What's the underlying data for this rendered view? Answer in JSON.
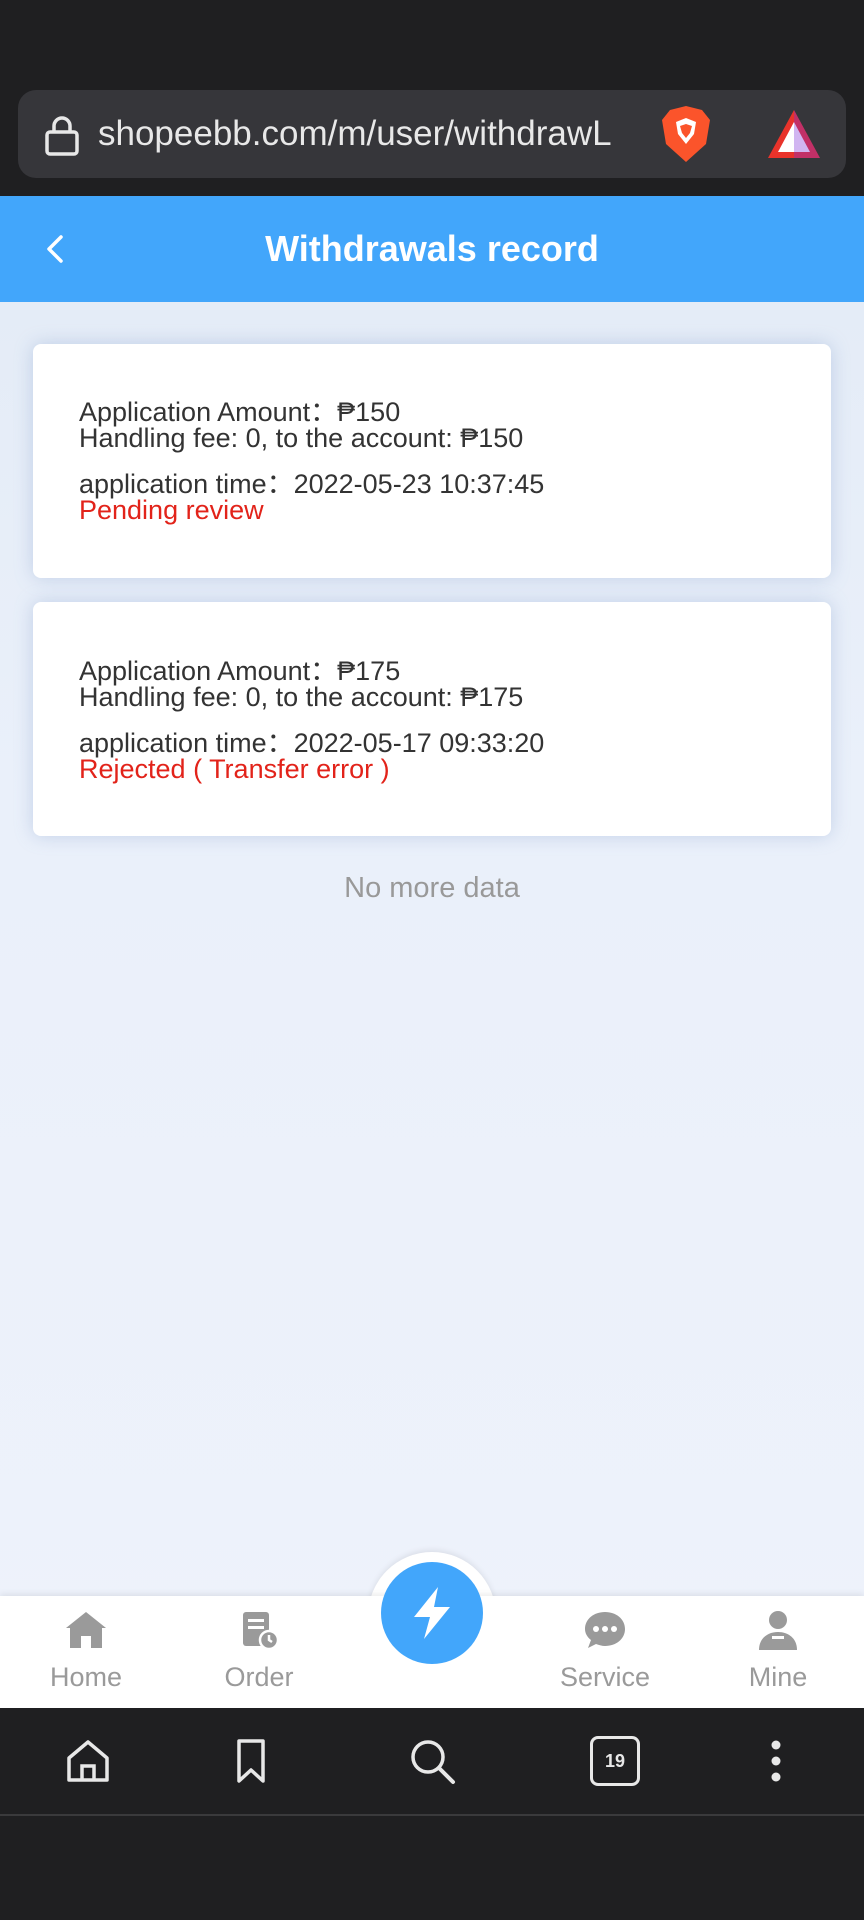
{
  "browser": {
    "url": "shopeebb.com/m/user/withdrawL",
    "tab_count": "19"
  },
  "header": {
    "title": "Withdrawals record"
  },
  "records": [
    {
      "amount": "Application Amount：₱150",
      "fee": "Handling fee: 0, to the account: ₱150",
      "time": "application time：2022-05-23 10:37:45",
      "status": "Pending review"
    },
    {
      "amount": "Application Amount：₱175",
      "fee": "Handling fee: 0, to the account: ₱175",
      "time": "application time：2022-05-17 09:33:20",
      "status": "Rejected ( Transfer error )"
    }
  ],
  "list_footer": "No more data",
  "tabbar": {
    "items": [
      {
        "label": "Home",
        "icon": "home-icon"
      },
      {
        "label": "Order",
        "icon": "order-icon"
      },
      {
        "label": "",
        "icon": "lightning-icon"
      },
      {
        "label": "Service",
        "icon": "chat-icon"
      },
      {
        "label": "Mine",
        "icon": "user-icon"
      }
    ]
  },
  "colors": {
    "accent": "#42a6fb",
    "status_red": "#e2231a",
    "browser_dark": "#1f1f21"
  }
}
